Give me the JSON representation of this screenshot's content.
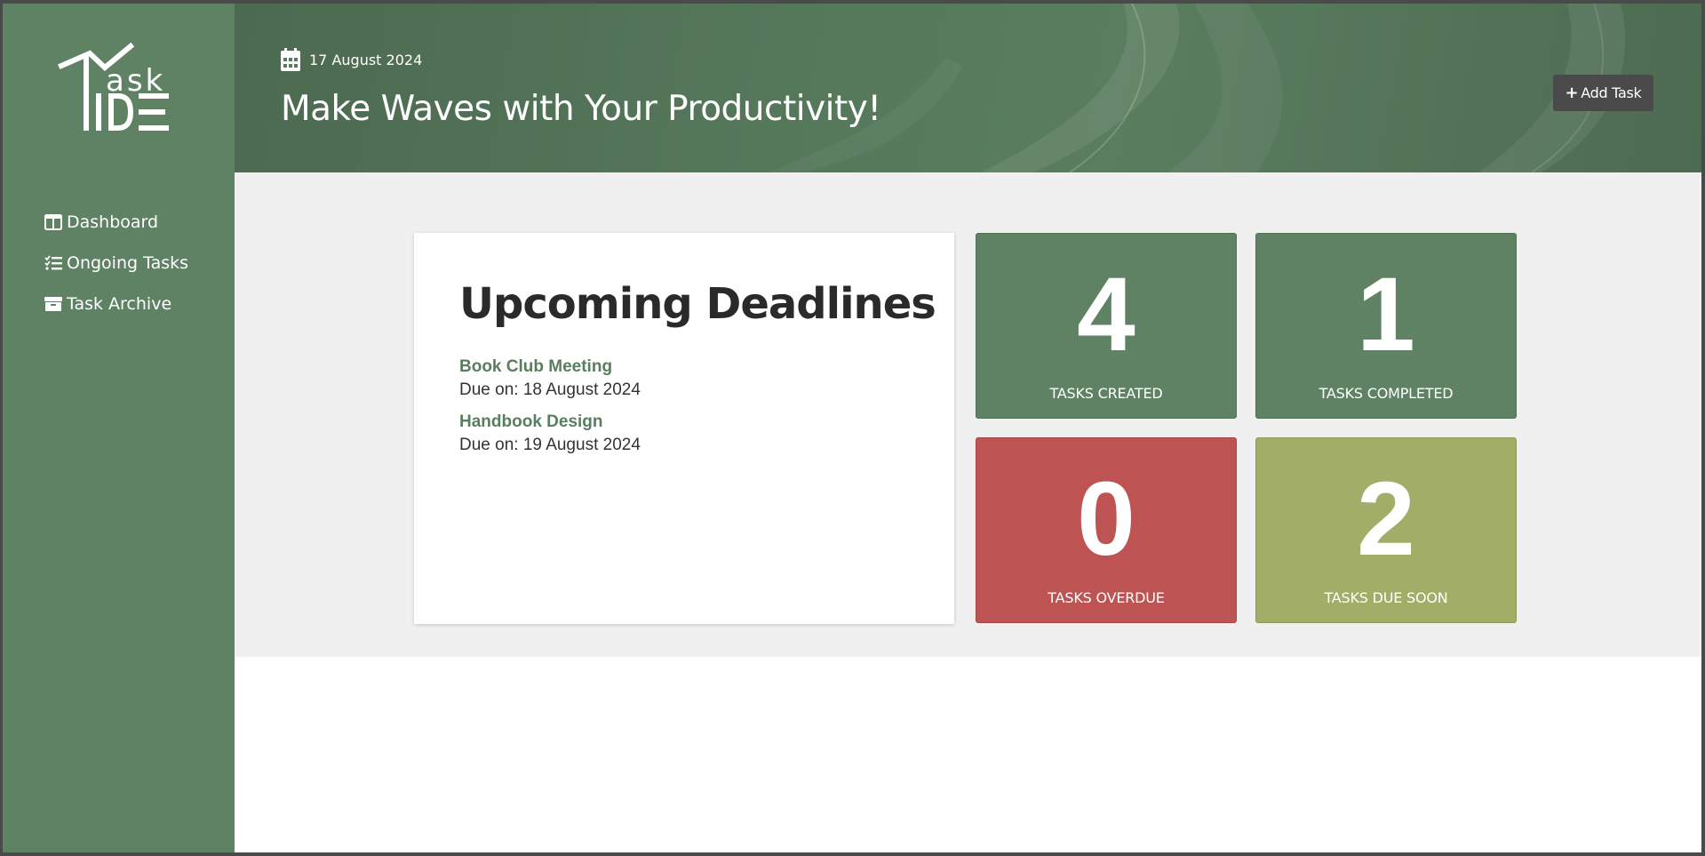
{
  "app": {
    "logo_text": "Task IDE"
  },
  "sidebar": {
    "items": [
      {
        "label": "Dashboard",
        "icon": "dashboard-columns-icon"
      },
      {
        "label": "Ongoing Tasks",
        "icon": "list-check-icon"
      },
      {
        "label": "Task Archive",
        "icon": "archive-box-icon"
      }
    ]
  },
  "header": {
    "date": "17 August 2024",
    "headline": "Make Waves with Your Productivity!",
    "add_button": {
      "icon": "+",
      "label": "Add Task"
    }
  },
  "deadlines": {
    "title": "Upcoming Deadlines",
    "items": [
      {
        "name": "Book Club Meeting",
        "due": "Due on: 18 August 2024"
      },
      {
        "name": "Handbook Design",
        "due": "Due on: 19 August 2024"
      }
    ]
  },
  "stats": {
    "created": {
      "value": "4",
      "label": "TASKS CREATED"
    },
    "completed": {
      "value": "1",
      "label": "TASKS COMPLETED"
    },
    "overdue": {
      "value": "0",
      "label": "TASKS OVERDUE"
    },
    "due_soon": {
      "value": "2",
      "label": "TASKS DUE SOON"
    }
  },
  "colors": {
    "sidebar": "#5f8164",
    "accent_green": "#5a7d5f",
    "overdue_red": "#bd5353",
    "due_soon_olive": "#a2ad68",
    "button_dark": "#4a4a4a"
  }
}
